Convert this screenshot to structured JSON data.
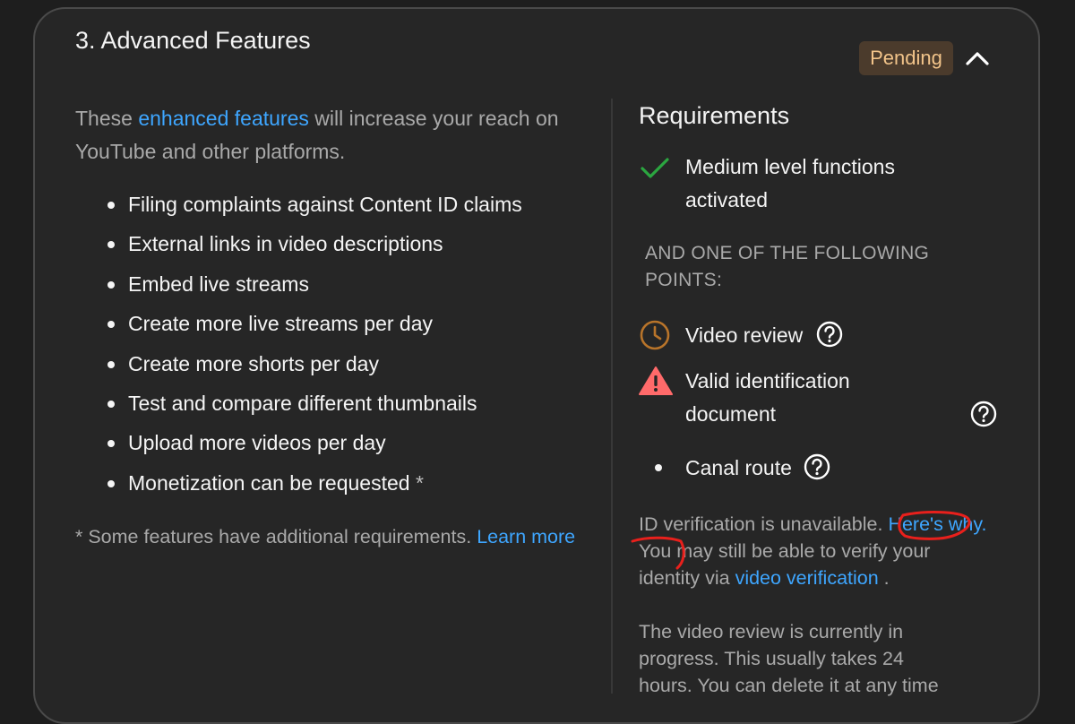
{
  "section": {
    "title": "3. Advanced Features",
    "status_badge": "Pending"
  },
  "intro": {
    "before_link": "These ",
    "link": "enhanced features",
    "after_link": " will increase your reach on YouTube and other platforms."
  },
  "features": [
    "Filing complaints against Content ID claims",
    "External links in video descriptions",
    "Embed live streams",
    "Create more live streams per day",
    "Create more shorts per day",
    "Test and compare different thumbnails",
    "Upload more videos per day",
    "Monetization can be requested"
  ],
  "features_last_asterisk": "*",
  "footnote": {
    "text": "* Some features have additional requirements. ",
    "link": "Learn more"
  },
  "requirements": {
    "title": "Requirements",
    "met": {
      "label": "Medium level functions activated",
      "icon": "check-icon"
    },
    "and_one_of": "AND ONE OF THE FOLLOWING POINTS:",
    "options": [
      {
        "label": "Video review",
        "icon": "clock-icon"
      },
      {
        "label": "Valid identification document",
        "icon": "warning-icon"
      },
      {
        "label": "Canal route",
        "icon": "bullet-icon"
      }
    ],
    "id_notice": {
      "text1": "ID verification is unavailable. ",
      "link1": "Here's why.",
      "text2": " You may still be able to verify your identity via ",
      "link2": "video verification",
      "text3": " ."
    },
    "review_notice": "The video review is currently in progress. This usually takes 24 hours. You can delete it at any time"
  },
  "colors": {
    "accent_link": "#3ea6ff",
    "check": "#2ba640",
    "clock": "#b8742a",
    "warning": "#ff6a6a",
    "badge_bg": "#4b3b2c",
    "badge_text": "#f2c48a",
    "annotation": "#e8201c"
  }
}
